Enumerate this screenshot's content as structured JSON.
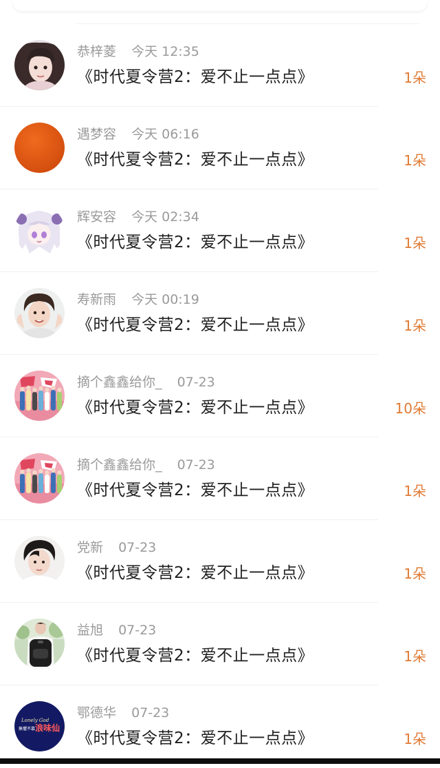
{
  "colors": {
    "count_accent": "#e07a33",
    "meta_text": "#9a9a9a",
    "title_text": "#1f1f1f"
  },
  "gifts": [
    {
      "name": "恭梓菱",
      "time": "今天 12:35",
      "title": "《时代夏令营2：爱不止一点点》",
      "count": "1朵",
      "avatar": "girl-photo-avatar"
    },
    {
      "name": "遇梦容",
      "time": "今天 06:16",
      "title": "《时代夏令营2：爱不止一点点》",
      "count": "1朵",
      "avatar": "orange-circle-avatar"
    },
    {
      "name": "辉安容",
      "time": "今天 02:34",
      "title": "《时代夏令营2：爱不止一点点》",
      "count": "1朵",
      "avatar": "anime-girl-avatar"
    },
    {
      "name": "寿新雨",
      "time": "今天 00:19",
      "title": "《时代夏令营2：爱不止一点点》",
      "count": "1朵",
      "avatar": "boy-portrait-avatar"
    },
    {
      "name": "摘个鑫鑫给你_",
      "time": "07-23",
      "title": "《时代夏令营2：爱不止一点点》",
      "count": "10朵",
      "avatar": "group-poster-avatar"
    },
    {
      "name": "摘个鑫鑫给你_",
      "time": "07-23",
      "title": "《时代夏令营2：爱不止一点点》",
      "count": "1朵",
      "avatar": "group-poster-avatar"
    },
    {
      "name": "党新",
      "time": "07-23",
      "title": "《时代夏令营2：爱不止一点点》",
      "count": "1朵",
      "avatar": "man-portrait-avatar"
    },
    {
      "name": "益旭",
      "time": "07-23",
      "title": "《时代夏令营2：爱不止一点点》",
      "count": "1朵",
      "avatar": "backpack-photo-avatar"
    },
    {
      "name": "鄂德华",
      "time": "07-23",
      "title": "《时代夏令营2：爱不止一点点》",
      "count": "1朵",
      "avatar": "navy-logo-avatar"
    }
  ],
  "avatar_logo_text": {
    "script": "Lonely God",
    "main": "浪味仙",
    "small": "無懼不慕"
  }
}
